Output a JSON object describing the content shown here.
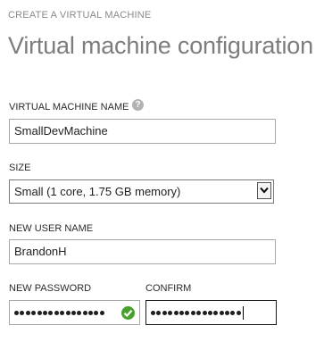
{
  "wizard": {
    "step_title": "CREATE A VIRTUAL MACHINE",
    "page_title": "Virtual machine configuration"
  },
  "form": {
    "vm_name": {
      "label": "VIRTUAL MACHINE NAME",
      "value": "SmallDevMachine",
      "help_icon": "question-mark-icon"
    },
    "size": {
      "label": "SIZE",
      "selected": "Small (1 core, 1.75 GB memory)"
    },
    "user_name": {
      "label": "NEW USER NAME",
      "value": "BrandonH"
    },
    "password": {
      "label": "NEW PASSWORD",
      "masked_length": 16,
      "valid": true,
      "status_icon": "check-icon"
    },
    "confirm": {
      "label": "CONFIRM",
      "masked_length": 16,
      "focused": true
    }
  },
  "colors": {
    "valid_check": "#48a12d",
    "title_gray": "#7d7d7d",
    "help_icon_gray": "#b3b3b3"
  }
}
